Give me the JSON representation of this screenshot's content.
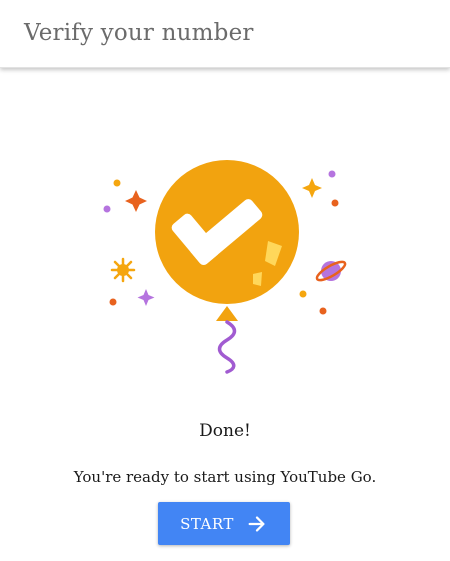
{
  "header": {
    "title": "Verify your number"
  },
  "illustration": {
    "icon": "balloon-checkmark-icon",
    "colors": {
      "balloon": "#f2a30f",
      "check": "#ffffff",
      "confetti": "#ffd75a",
      "string": "#a15bd1",
      "orange": "#e8621e",
      "purple": "#b574df",
      "star": "#f5a60f"
    }
  },
  "status": {
    "title": "Done!",
    "message": "You're ready to start using YouTube Go."
  },
  "actions": {
    "start_label": "START",
    "start_icon": "arrow-right-icon",
    "button_color": "#4285f4"
  }
}
